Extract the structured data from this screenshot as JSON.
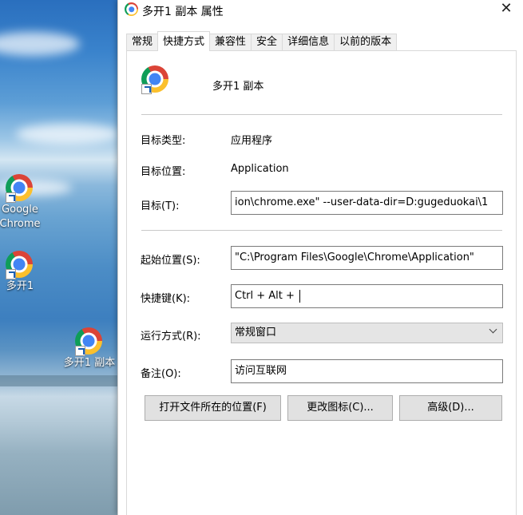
{
  "desktop": {
    "icons": [
      {
        "label_line1": "Google",
        "label_line2": "Chrome"
      },
      {
        "label_line1": "多开1"
      },
      {
        "label_line1": "多开1 副本"
      }
    ]
  },
  "window": {
    "title": "多开1 副本 属性",
    "close_glyph": "✕"
  },
  "tabs": [
    {
      "label": "常规"
    },
    {
      "label": "快捷方式",
      "active": true
    },
    {
      "label": "兼容性"
    },
    {
      "label": "安全"
    },
    {
      "label": "详细信息"
    },
    {
      "label": "以前的版本"
    }
  ],
  "shortcut": {
    "name": "多开1 副本",
    "target_type_label": "目标类型:",
    "target_type_value": "应用程序",
    "target_location_label": "目标位置:",
    "target_location_value": "Application",
    "target_label": "目标(T):",
    "target_value": "ion\\chrome.exe\" --user-data-dir=D:gugeduokai\\1",
    "start_in_label": "起始位置(S):",
    "start_in_value": "\"C:\\Program Files\\Google\\Chrome\\Application\"",
    "hotkey_label": "快捷键(K):",
    "hotkey_value": "Ctrl + Alt + ",
    "run_label": "运行方式(R):",
    "run_value": "常规窗口",
    "comment_label": "备注(O):",
    "comment_value": "访问互联网"
  },
  "buttons": {
    "open_location": "打开文件所在的位置(F)",
    "change_icon": "更改图标(C)...",
    "advanced": "高级(D)..."
  },
  "icons": {
    "app": "chrome-icon",
    "shortcut_overlay": "shortcut-arrow-icon",
    "close": "close-icon",
    "dropdown": "chevron-down-icon"
  }
}
